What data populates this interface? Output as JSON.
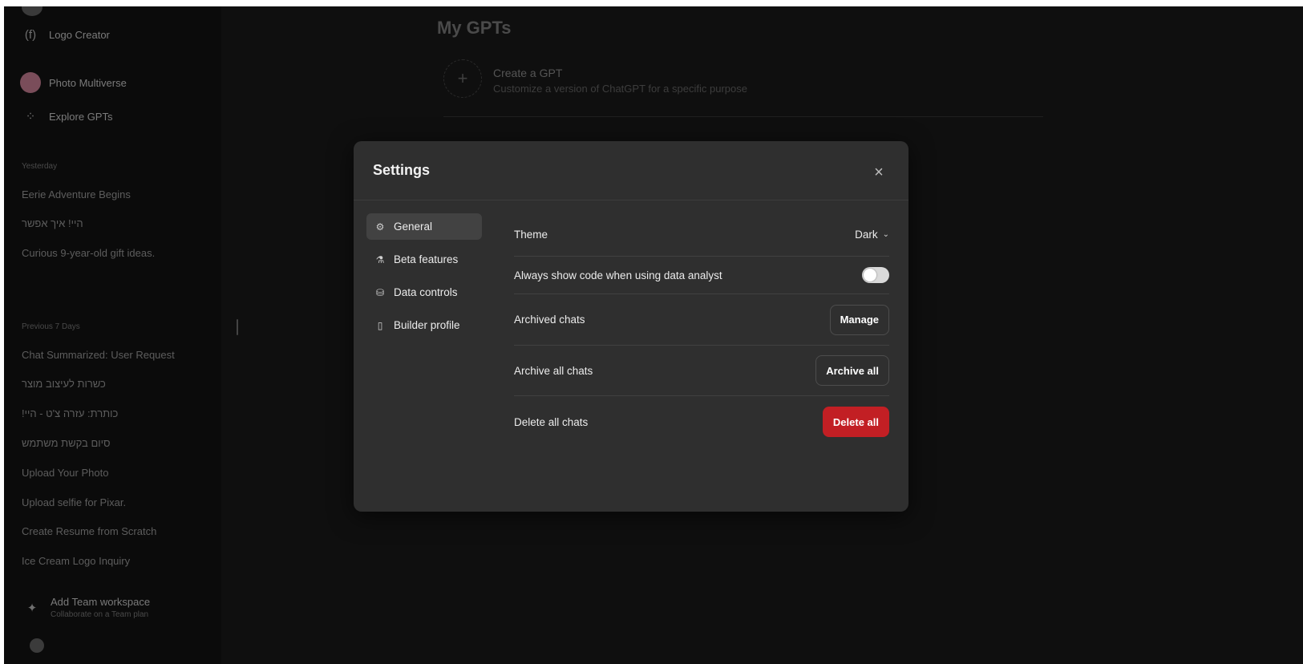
{
  "sidebar": {
    "gpts": [
      {
        "label": "Logo Creator",
        "icon": "logo-creator-icon",
        "glyph": "(f)"
      },
      {
        "label": "Photo Multiverse",
        "icon": "photo-multiverse-avatar",
        "glyph": ""
      },
      {
        "label": "Explore GPTs",
        "icon": "grid-icon",
        "glyph": "⁘"
      }
    ],
    "sections": {
      "yesterday": "Yesterday",
      "previous_7_days": "Previous 7 Days"
    },
    "yesterday_chats": [
      "Eerie Adventure Begins",
      "היי! איך אפשר",
      "Curious 9-year-old gift ideas."
    ],
    "previous_chats": [
      "Chat Summarized: User Request",
      "כשרות לעיצוב מוצר",
      "כותרת: עזרה צ'ט - היי!",
      "סיום בקשת משתמש",
      "Upload Your Photo",
      "Upload selfie for Pixar.",
      "Create Resume from Scratch",
      "Ice Cream Logo Inquiry"
    ],
    "team": {
      "title": "Add Team workspace",
      "subtitle": "Collaborate on a Team plan"
    }
  },
  "main": {
    "title": "My GPTs",
    "create": {
      "title": "Create a GPT",
      "subtitle": "Customize a version of ChatGPT for a specific purpose"
    }
  },
  "modal": {
    "title": "Settings",
    "close_icon": "×",
    "nav": [
      {
        "label": "General",
        "glyph": "⚙",
        "active": true
      },
      {
        "label": "Beta features",
        "glyph": "⚗",
        "active": false
      },
      {
        "label": "Data controls",
        "glyph": "⛁",
        "active": false
      },
      {
        "label": "Builder profile",
        "glyph": "▯",
        "active": false
      }
    ],
    "general": {
      "theme_label": "Theme",
      "theme_value": "Dark",
      "code_label": "Always show code when using data analyst",
      "code_toggle_on": false,
      "archived_label": "Archived chats",
      "archived_button": "Manage",
      "archive_all_label": "Archive all chats",
      "archive_all_button": "Archive all",
      "delete_all_label": "Delete all chats",
      "delete_all_button": "Delete all"
    }
  },
  "colors": {
    "danger": "#c21f24",
    "modal_bg": "#2f2f2f",
    "page_bg": "#0f0f0f"
  }
}
